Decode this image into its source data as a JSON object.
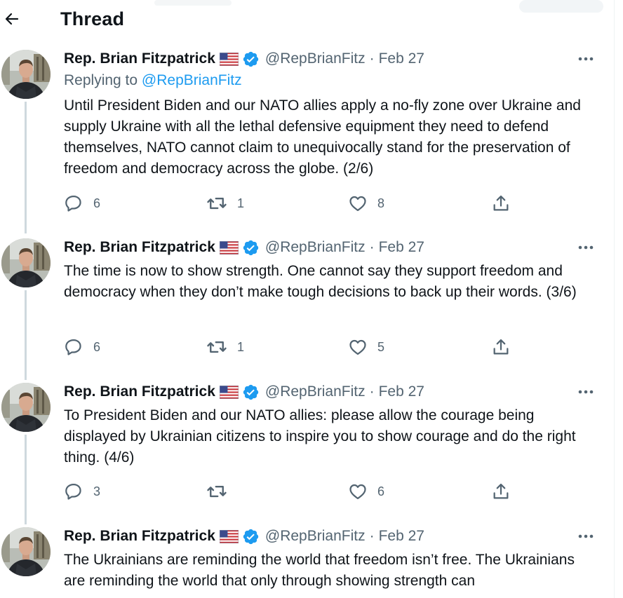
{
  "header": {
    "title": "Thread",
    "back_icon": "arrow-left-icon"
  },
  "colors": {
    "accent": "#1d9bf0",
    "secondary_text": "#536471",
    "primary_text": "#0f1419",
    "thread_line": "#cfd9de"
  },
  "tweets": [
    {
      "author_name": "Rep. Brian Fitzpatrick",
      "handle": "@RepBrianFitz",
      "separator": "·",
      "time": "Feb 27",
      "replying_prefix": "Replying to",
      "replying_to": "@RepBrianFitz",
      "text": "Until President Biden and our NATO allies apply a no-fly zone over Ukraine and supply Ukraine with all the lethal defensive equipment they need to defend themselves, NATO cannot claim to unequivocally stand for the preservation of freedom and democracy across the globe. (2/6)",
      "replies": "6",
      "retweets": "1",
      "likes": "8"
    },
    {
      "author_name": "Rep. Brian Fitzpatrick",
      "handle": "@RepBrianFitz",
      "separator": "·",
      "time": "Feb 27",
      "text": "The time is now to show strength. One cannot say they support freedom and democracy when they don’t make tough decisions to back up their words. (3/6)",
      "replies": "6",
      "retweets": "1",
      "likes": "5"
    },
    {
      "author_name": "Rep. Brian Fitzpatrick",
      "handle": "@RepBrianFitz",
      "separator": "·",
      "time": "Feb 27",
      "text": "To President Biden and our NATO allies: please allow the courage being displayed by Ukrainian citizens to inspire you to show courage and do the right thing.  (4/6)",
      "replies": "3",
      "retweets": "",
      "likes": "6"
    },
    {
      "author_name": "Rep. Brian Fitzpatrick",
      "handle": "@RepBrianFitz",
      "separator": "·",
      "time": "Feb 27",
      "text": "The Ukrainians are reminding the world that freedom isn’t free. The Ukrainians are reminding the world that only through showing strength can"
    }
  ]
}
